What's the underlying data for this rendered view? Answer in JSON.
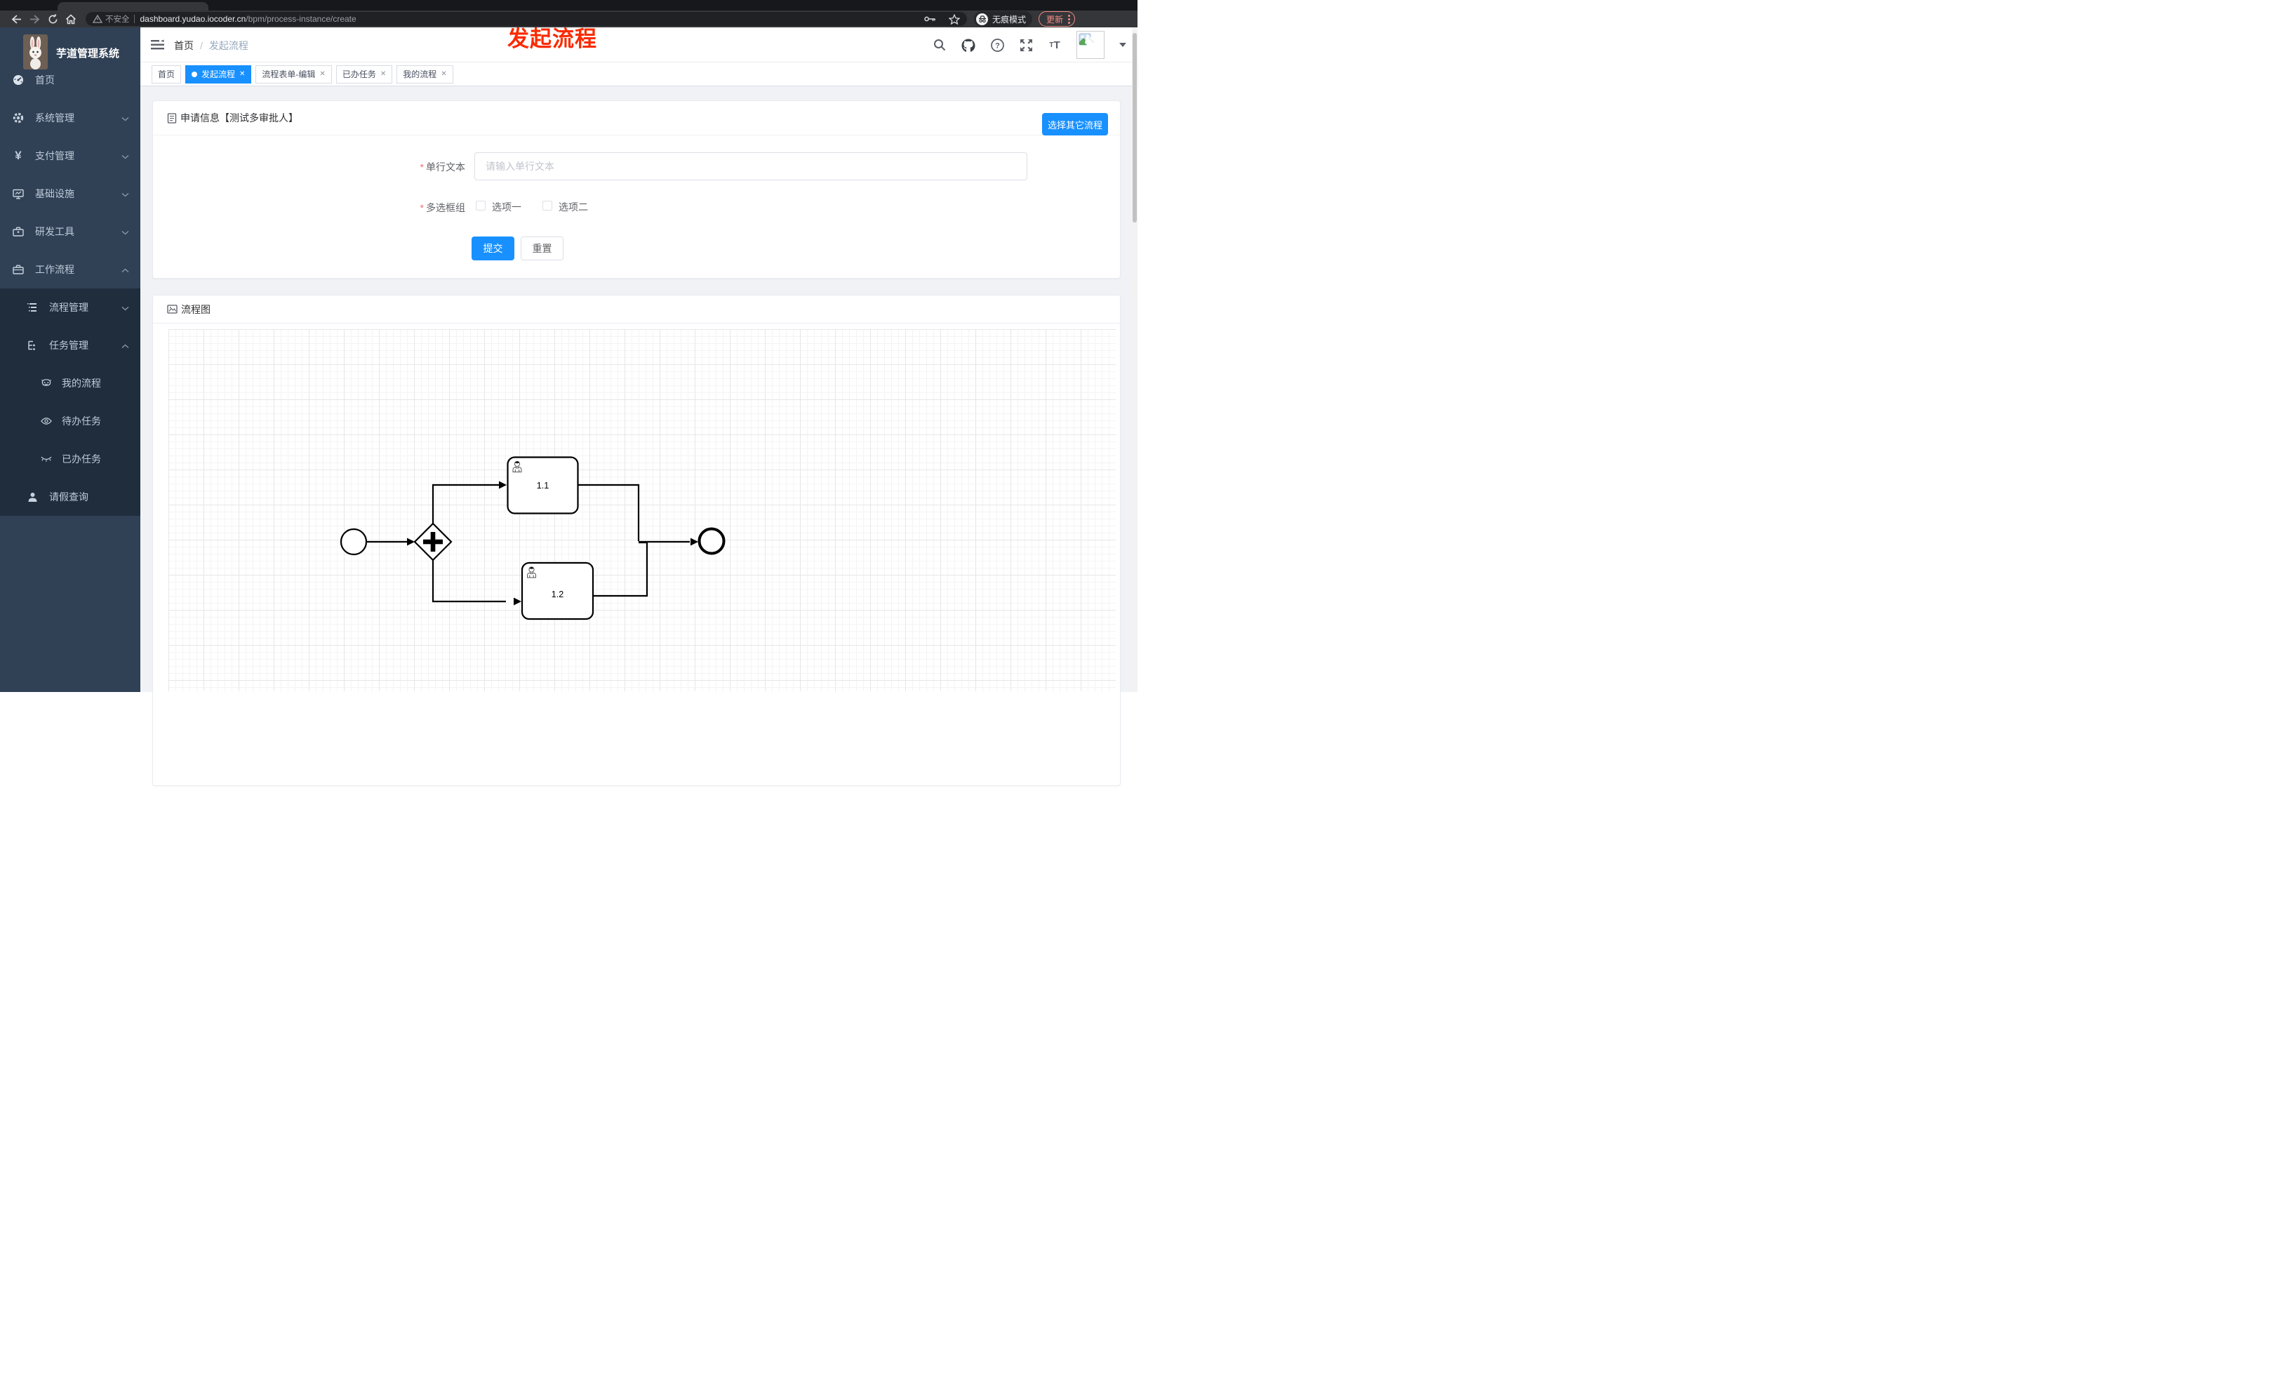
{
  "browser": {
    "security_label": "不安全",
    "url_host": "dashboard.yudao.iocoder.cn",
    "url_path": "/bpm/process-instance/create",
    "incognito_label": "无痕模式",
    "update_label": "更新"
  },
  "annotation": {
    "text": "发起流程",
    "color": "#f92b00"
  },
  "sidebar": {
    "title": "芋道管理系统",
    "items": [
      {
        "label": "首页",
        "icon": "dashboard-icon",
        "level": 1
      },
      {
        "label": "系统管理",
        "icon": "gear-icon",
        "level": 1,
        "state": "collapsed"
      },
      {
        "label": "支付管理",
        "icon": "yuan-icon",
        "level": 1,
        "state": "collapsed"
      },
      {
        "label": "基础设施",
        "icon": "monitor-icon",
        "level": 1,
        "state": "collapsed"
      },
      {
        "label": "研发工具",
        "icon": "toolbox-icon",
        "level": 1,
        "state": "collapsed"
      },
      {
        "label": "工作流程",
        "icon": "briefcase-icon",
        "level": 1,
        "state": "expanded"
      },
      {
        "label": "流程管理",
        "icon": "list-tree-icon",
        "level": 2,
        "state": "collapsed"
      },
      {
        "label": "任务管理",
        "icon": "flow-icon",
        "level": 2,
        "state": "expanded"
      },
      {
        "label": "我的流程",
        "icon": "robot-face-icon",
        "level": 3
      },
      {
        "label": "待办任务",
        "icon": "eye-open-icon",
        "level": 3
      },
      {
        "label": "已办任务",
        "icon": "eye-closed-icon",
        "level": 3
      },
      {
        "label": "请假查询",
        "icon": "person-icon",
        "level": 2
      }
    ]
  },
  "navbar": {
    "breadcrumb": [
      {
        "label": "首页"
      },
      {
        "label": "发起流程"
      }
    ]
  },
  "tabs": {
    "items": [
      {
        "label": "首页",
        "active": false,
        "closable": false
      },
      {
        "label": "发起流程",
        "active": true,
        "closable": true
      },
      {
        "label": "流程表单-编辑",
        "active": false,
        "closable": true
      },
      {
        "label": "已办任务",
        "active": false,
        "closable": true
      },
      {
        "label": "我的流程",
        "active": false,
        "closable": true
      }
    ]
  },
  "form_card": {
    "title": "申请信息【测试多审批人】",
    "choose_other_button": "选择其它流程",
    "fields": [
      {
        "label": "单行文本",
        "required": true,
        "type": "text",
        "value": "",
        "placeholder": "请输入单行文本"
      },
      {
        "label": "多选框组",
        "required": true,
        "type": "checkbox-group",
        "options": [
          {
            "label": "选项一",
            "checked": false
          },
          {
            "label": "选项二",
            "checked": false
          }
        ]
      }
    ],
    "submit_label": "提交",
    "reset_label": "重置"
  },
  "diagram_card": {
    "title": "流程图",
    "process": {
      "nodes": [
        {
          "id": "start",
          "type": "startEvent",
          "label": ""
        },
        {
          "id": "gateway",
          "type": "parallelGateway",
          "label": ""
        },
        {
          "id": "task1",
          "type": "userTask",
          "label": "1.1"
        },
        {
          "id": "task2",
          "type": "userTask",
          "label": "1.2"
        },
        {
          "id": "end",
          "type": "endEvent",
          "label": ""
        }
      ],
      "flows": [
        [
          "start",
          "gateway"
        ],
        [
          "gateway",
          "task1"
        ],
        [
          "gateway",
          "task2"
        ],
        [
          "task1",
          "end"
        ],
        [
          "task2",
          "end"
        ]
      ]
    }
  },
  "colors": {
    "accent": "#1890ff",
    "sidebar_bg": "#304156",
    "submenu_bg": "#1f2d3d",
    "sidebar_text": "#bfcbd9",
    "annotation_red": "#f92b00",
    "required_red": "#f56c6c",
    "chrome_toolbar": "#35363a",
    "update_chip": "#f28b82",
    "tag_border": "#d8dce5"
  }
}
